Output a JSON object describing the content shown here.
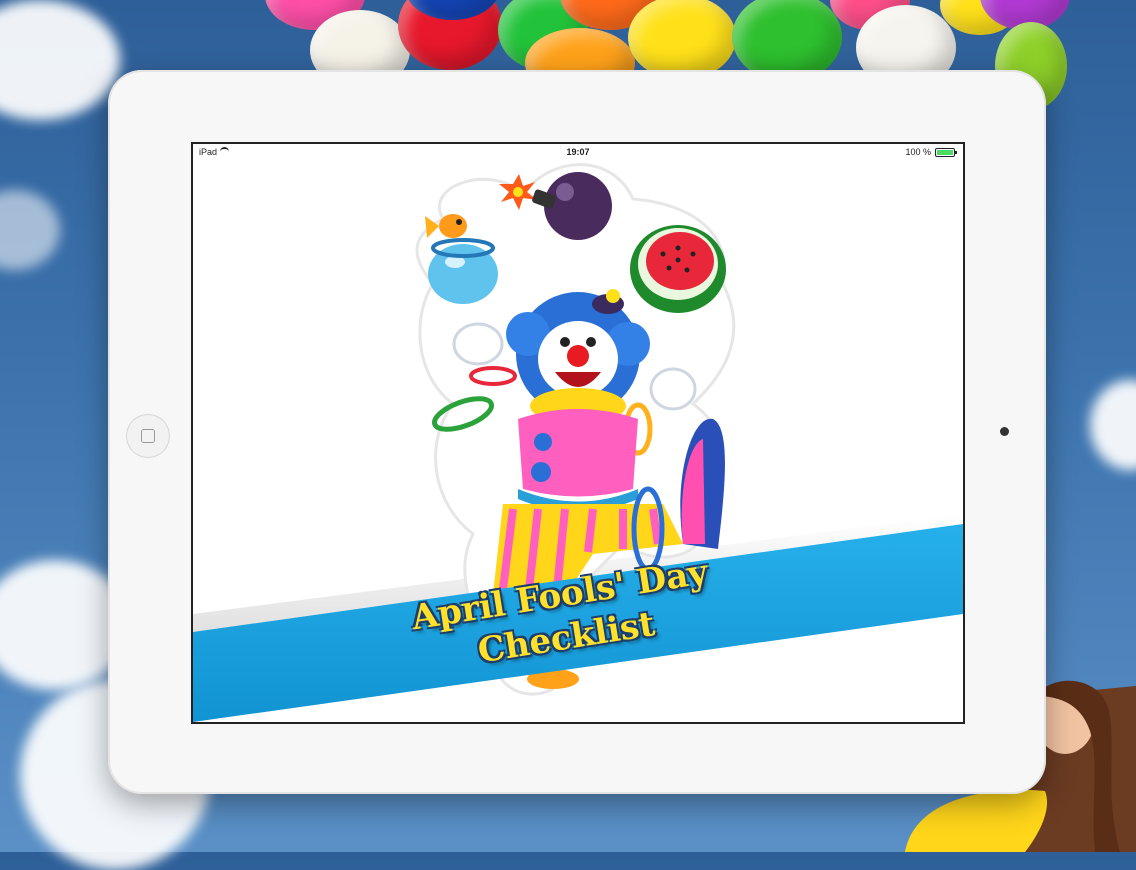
{
  "status_bar": {
    "device": "iPad",
    "time": "19:07",
    "battery": "100 %"
  },
  "banner": {
    "line1": "April Fools' Day",
    "line2": "Checklist"
  },
  "colors": {
    "sky": "#3d74ae",
    "banner_blue": "#1ea3e0",
    "title_yellow": "#ffe12b",
    "ipad_frame": "#f7f7f7"
  }
}
